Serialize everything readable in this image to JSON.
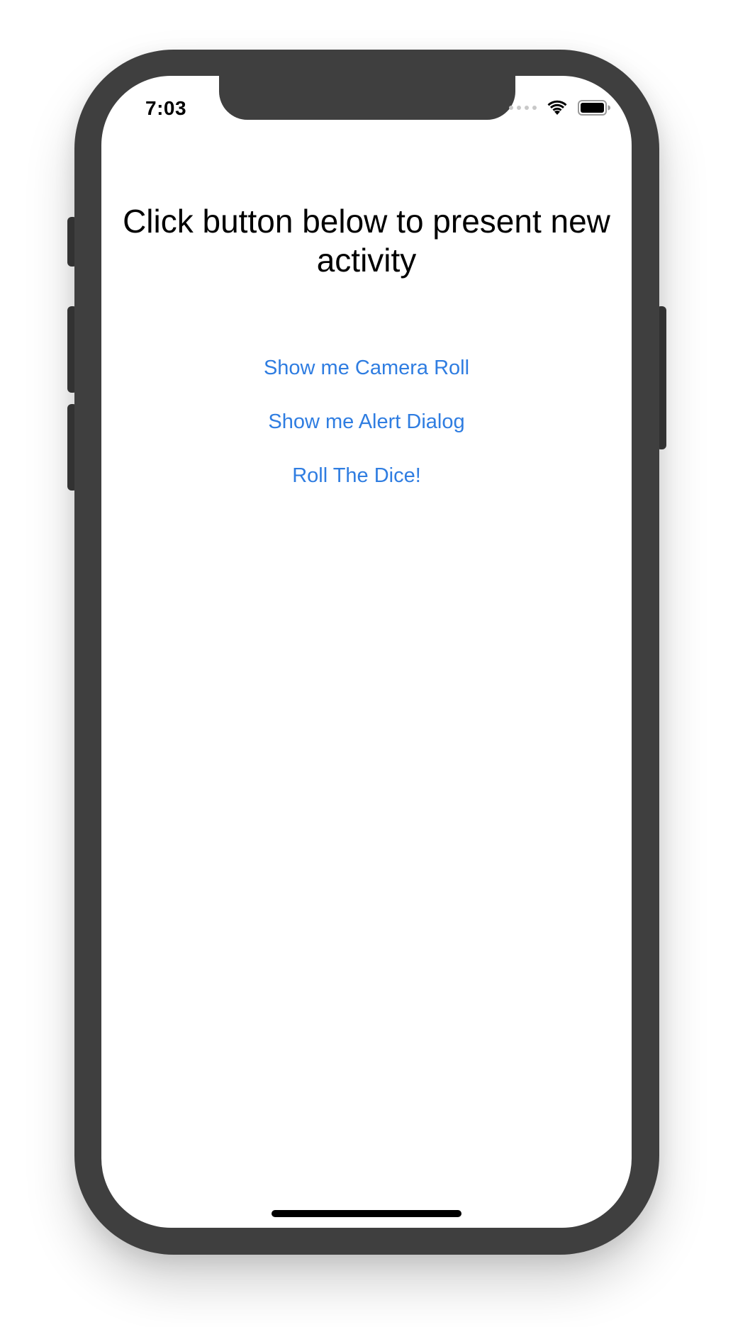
{
  "status_bar": {
    "time": "7:03",
    "signal_icon": "cellular-signal-icon",
    "wifi_icon": "wifi-icon",
    "battery_icon": "battery-icon"
  },
  "main": {
    "title": "Click button below to present new activity",
    "buttons": [
      {
        "label": "Show me Camera Roll"
      },
      {
        "label": "Show me Alert Dialog"
      },
      {
        "label": "Roll The Dice!"
      }
    ]
  },
  "colors": {
    "link": "#2f7de1",
    "frame": "#3f3f3f",
    "background": "#ffffff"
  }
}
